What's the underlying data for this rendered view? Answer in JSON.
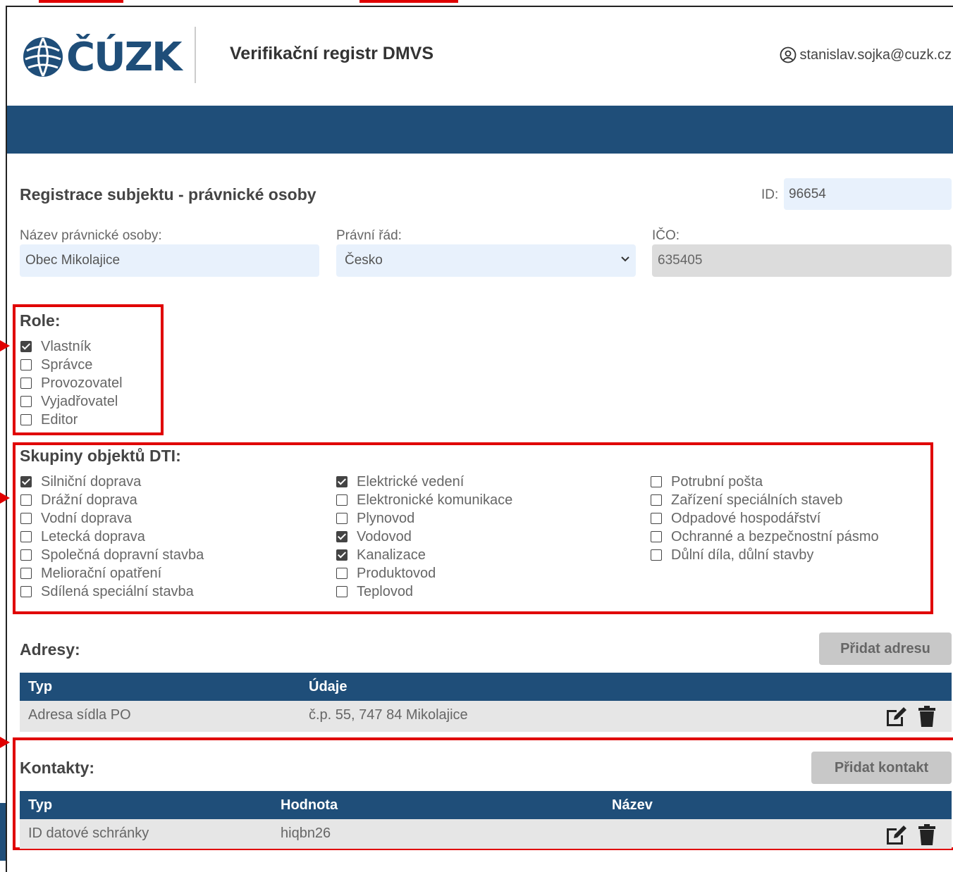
{
  "header": {
    "logo_text": "ČÚZK",
    "app_title": "Verifikační registr DMVS",
    "user_email": "stanislav.sojka@cuzk.cz"
  },
  "form": {
    "title": "Registrace subjektu - právnické osoby",
    "id_label": "ID:",
    "id_value": "96654",
    "name_label": "Název právnické osoby:",
    "name_value": "Obec Mikolajice",
    "legal_label": "Právní řád:",
    "legal_value": "Česko",
    "ico_label": "IČO:",
    "ico_value": "635405"
  },
  "roles": {
    "title": "Role:",
    "items": [
      {
        "label": "Vlastník",
        "checked": true
      },
      {
        "label": "Správce",
        "checked": false
      },
      {
        "label": "Provozovatel",
        "checked": false
      },
      {
        "label": "Vyjadřovatel",
        "checked": false
      },
      {
        "label": "Editor",
        "checked": false
      }
    ]
  },
  "groups": {
    "title": "Skupiny objektů DTI:",
    "col1": [
      {
        "label": "Silniční doprava",
        "checked": true
      },
      {
        "label": "Drážní doprava",
        "checked": false
      },
      {
        "label": "Vodní doprava",
        "checked": false
      },
      {
        "label": "Letecká doprava",
        "checked": false
      },
      {
        "label": "Společná dopravní stavba",
        "checked": false
      },
      {
        "label": "Meliorační opatření",
        "checked": false
      },
      {
        "label": "Sdílená speciální stavba",
        "checked": false
      }
    ],
    "col2": [
      {
        "label": "Elektrické vedení",
        "checked": true
      },
      {
        "label": "Elektronické komunikace",
        "checked": false
      },
      {
        "label": "Plynovod",
        "checked": false
      },
      {
        "label": "Vodovod",
        "checked": true
      },
      {
        "label": "Kanalizace",
        "checked": true
      },
      {
        "label": "Produktovod",
        "checked": false
      },
      {
        "label": "Teplovod",
        "checked": false
      }
    ],
    "col3": [
      {
        "label": "Potrubní pošta",
        "checked": false
      },
      {
        "label": "Zařízení speciálních staveb",
        "checked": false
      },
      {
        "label": "Odpadové hospodářství",
        "checked": false
      },
      {
        "label": "Ochranné a bezpečnostní pásmo",
        "checked": false
      },
      {
        "label": "Důlní díla, důlní stavby",
        "checked": false
      }
    ]
  },
  "addresses": {
    "title": "Adresy:",
    "add_button": "Přidat adresu",
    "col_type": "Typ",
    "col_data": "Údaje",
    "rows": [
      {
        "type": "Adresa sídla PO",
        "data": "č.p. 55, 747 84 Mikolajice"
      }
    ]
  },
  "contacts": {
    "title": "Kontakty:",
    "add_button": "Přidat kontakt",
    "col_type": "Typ",
    "col_value": "Hodnota",
    "col_name": "Název",
    "rows": [
      {
        "type": "ID datové schránky",
        "value": "hiqbn26",
        "name": ""
      }
    ]
  },
  "colors": {
    "brand": "#1f4e79",
    "highlight": "#e00000",
    "input_bg": "#e8f1fc"
  }
}
